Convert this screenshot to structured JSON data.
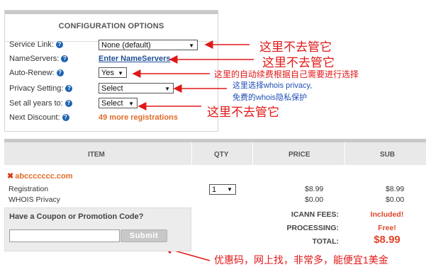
{
  "config": {
    "title": "CONFIGURATION OPTIONS",
    "rows": [
      {
        "label": "Service Link:",
        "value": "None (default)",
        "type": "select"
      },
      {
        "label": "NameServers:",
        "value": "Enter NameServers",
        "type": "link"
      },
      {
        "label": "Auto-Renew:",
        "value": "Yes",
        "type": "select"
      },
      {
        "label": "Privacy Setting:",
        "value": "Select",
        "type": "select"
      },
      {
        "label": "Set all years to:",
        "value": "Select",
        "type": "select"
      },
      {
        "label": "Next Discount:",
        "value": "49 more registrations",
        "type": "text"
      }
    ],
    "help_icon": "question-circle-icon"
  },
  "annotations": {
    "a1": "这里不去管它",
    "a2": "这里不去管它",
    "a3": "这里的自动续费根据自己需要进行选择",
    "a4_line1": "这里选择whois privacy,",
    "a4_line2": "免费的whois隐私保护",
    "a5": "这里不去管它",
    "a6": "优惠码，网上找，非常多，能便宜1美金"
  },
  "cart": {
    "headers": {
      "item": "ITEM",
      "qty": "QTY",
      "price": "PRICE",
      "sub": "SUB"
    },
    "domain": "abccccccc.com",
    "remove_icon": "close-x-icon",
    "lines": [
      {
        "name": "Registration",
        "price": "$8.99",
        "sub": "$8.99"
      },
      {
        "name": "WHOIS Privacy",
        "price": "$0.00",
        "sub": "$0.00"
      }
    ],
    "qty": "1",
    "coupon": {
      "title": "Have a Coupon or Promotion Code?",
      "button": "Submit",
      "value": ""
    },
    "fees": [
      {
        "label": "ICANN FEES:",
        "value": "Included!"
      },
      {
        "label": "PROCESSING:",
        "value": "Free!"
      },
      {
        "label": "TOTAL:",
        "value": "$8.99"
      }
    ]
  },
  "colors": {
    "accent_orange": "#e06c2a",
    "link_blue": "#1f4e97",
    "annotation_red": "#e01818",
    "annotation_blue": "#1f4fb5"
  }
}
